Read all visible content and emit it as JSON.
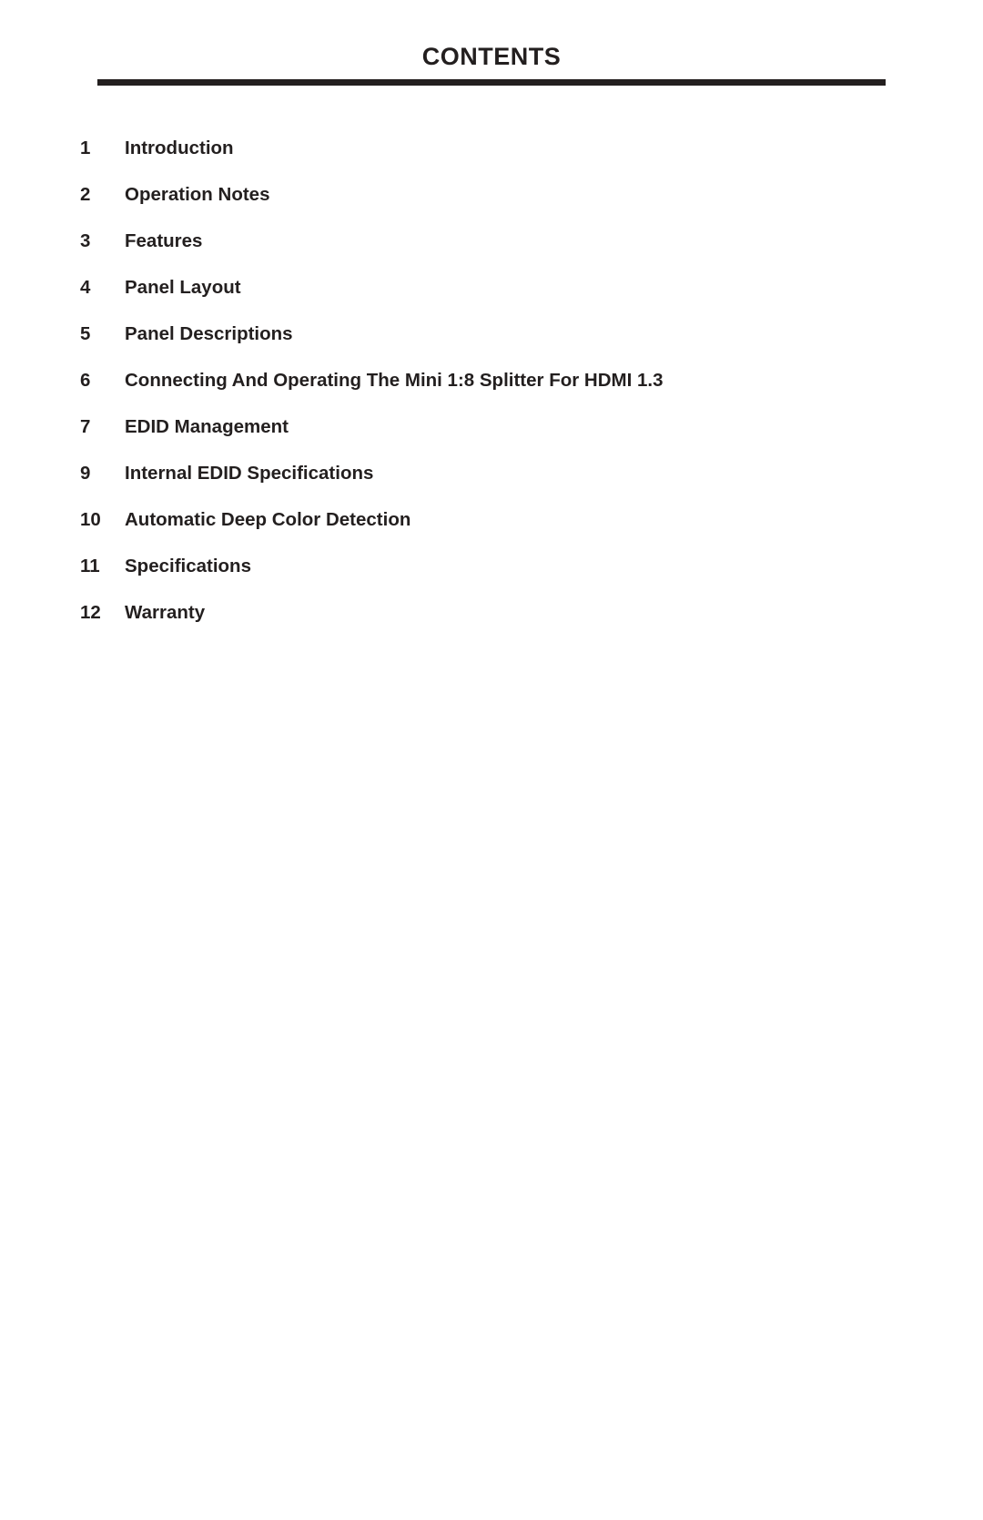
{
  "document": {
    "title": "CONTENTS"
  },
  "contents": {
    "entries": [
      {
        "number": "1",
        "label": "Introduction"
      },
      {
        "number": "2",
        "label": "Operation Notes"
      },
      {
        "number": "3",
        "label": "Features"
      },
      {
        "number": "4",
        "label": "Panel Layout"
      },
      {
        "number": "5",
        "label": "Panel Descriptions"
      },
      {
        "number": "6",
        "label": "Connecting And Operating The Mini 1:8 Splitter For HDMI 1.3"
      },
      {
        "number": "7",
        "label": "EDID Management"
      },
      {
        "number": "9",
        "label": "Internal EDID Specifications"
      },
      {
        "number": "10",
        "label": "Automatic Deep Color Detection"
      },
      {
        "number": "11",
        "label": "Specifications"
      },
      {
        "number": "12",
        "label": "Warranty"
      }
    ]
  },
  "colors": {
    "ink": "#231f1f",
    "background": "#ffffff"
  }
}
